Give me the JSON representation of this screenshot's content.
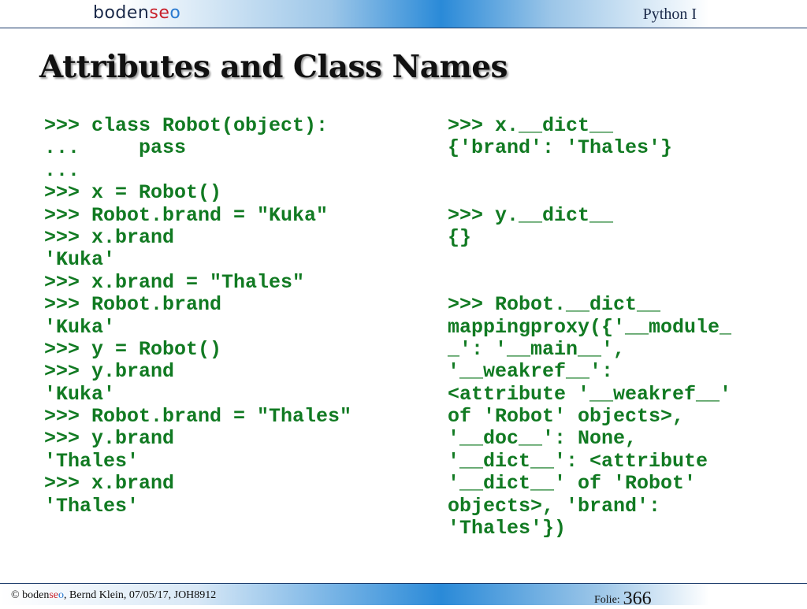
{
  "header": {
    "logo": {
      "part1": "boden",
      "part2": "se",
      "part3": "o"
    },
    "course": "Python I"
  },
  "slide": {
    "title": "Attributes and Class Names",
    "code_left": [
      ">>> class Robot(object):",
      "...     pass",
      "...",
      ">>> x = Robot()",
      ">>> Robot.brand = \"Kuka\"",
      ">>> x.brand",
      "'Kuka'",
      ">>> x.brand = \"Thales\"",
      ">>> Robot.brand",
      "'Kuka'",
      ">>> y = Robot()",
      ">>> y.brand",
      "'Kuka'",
      ">>> Robot.brand = \"Thales\"",
      ">>> y.brand",
      "'Thales'",
      ">>> x.brand",
      "'Thales'"
    ],
    "code_right": [
      ">>> x.__dict__",
      "{'brand': 'Thales'}",
      "",
      "",
      ">>> y.__dict__",
      "{}",
      "",
      "",
      ">>> Robot.__dict__",
      "mappingproxy({'__module_",
      "_': '__main__',",
      "'__weakref__':",
      "<attribute '__weakref__'",
      "of 'Robot' objects>,",
      "'__doc__': None,",
      "'__dict__': <attribute",
      "'__dict__' of 'Robot'",
      "objects>, 'brand':",
      "'Thales'})"
    ]
  },
  "footer": {
    "copyright": "©",
    "logo": {
      "part1": "boden",
      "part2": "se",
      "part3": "o"
    },
    "author_info": ", Bernd Klein, 07/05/17, JOH8912",
    "folie_label": "Folie:",
    "folie_number": "366"
  }
}
